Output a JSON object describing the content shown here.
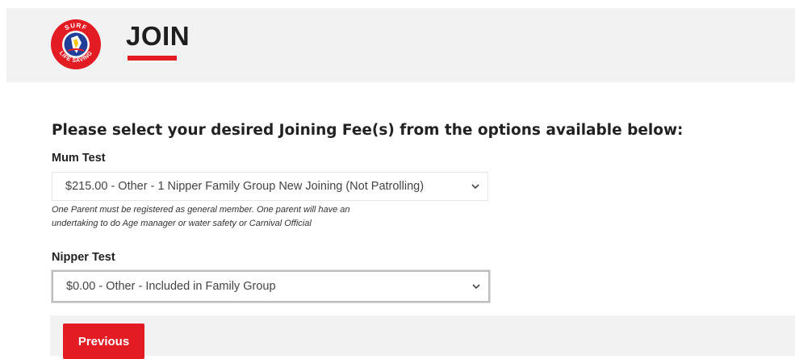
{
  "header": {
    "logo": {
      "icon": "surf-life-saving-logo",
      "text_top": "SURF",
      "text_bottom": "LIFE SAVING",
      "colors": {
        "red": "#e31b23",
        "blue": "#1f3f99",
        "yellow": "#f5c400"
      }
    },
    "title": "JOIN"
  },
  "form": {
    "heading": "Please select your desired Joining Fee(s) from the options available below:",
    "members": [
      {
        "name": "Mum Test",
        "selected_option": "$215.00 - Other - 1 Nipper Family Group New Joining (Not Patrolling)",
        "helper_lines": [
          "One Parent must be registered as general member. One parent will have an",
          "undertaking to do Age manager or water safety or Carnival Official"
        ]
      },
      {
        "name": "Nipper Test",
        "selected_option": "$0.00 - Other - Included in Family Group"
      }
    ]
  },
  "footer": {
    "previous_label": "Previous"
  },
  "colors": {
    "accent": "#e31b23",
    "header_bg": "#f2f2f2"
  }
}
